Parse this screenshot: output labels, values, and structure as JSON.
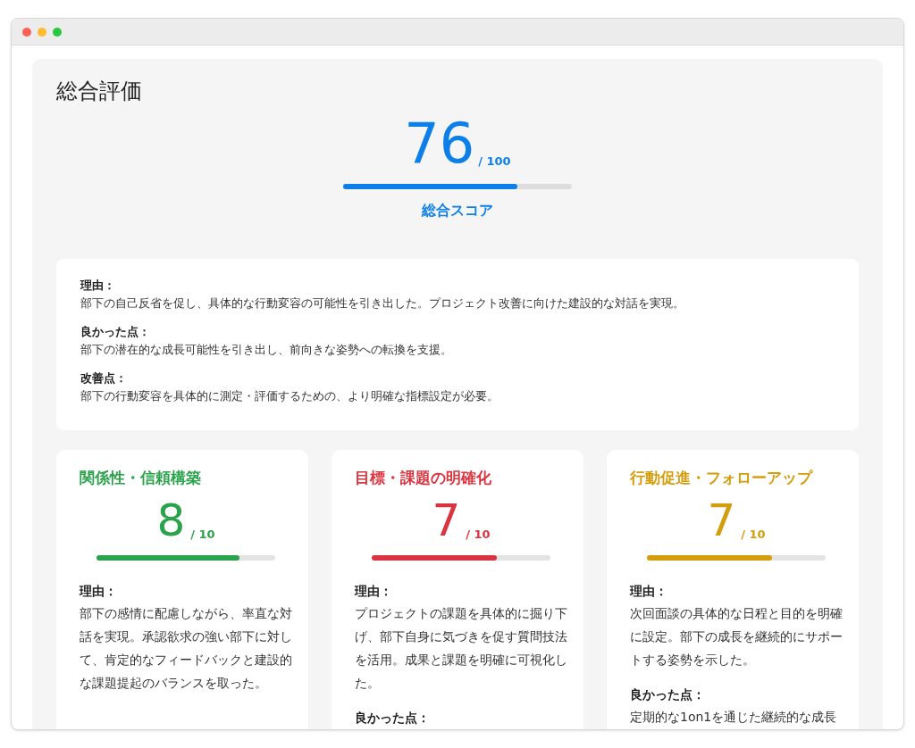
{
  "overall": {
    "title": "総合評価",
    "score": "76",
    "max": "/ 100",
    "level": 0.76,
    "label": "総合スコア"
  },
  "summary": [
    {
      "heading": "理由：",
      "text": "部下の自己反省を促し、具体的な行動変容の可能性を引き出した。プロジェクト改善に向けた建設的な対話を実現。"
    },
    {
      "heading": "良かった点：",
      "text": "部下の潜在的な成長可能性を引き出し、前向きな姿勢への転換を支援。"
    },
    {
      "heading": "改善点：",
      "text": "部下の行動変容を具体的に測定・評価するための、より明確な指標設定が必要。"
    }
  ],
  "categories": [
    {
      "title": "関係性・信頼構築",
      "color": "#2ba24c",
      "score": "8",
      "max": "/ 10",
      "level": 0.8,
      "sections": [
        {
          "heading": "理由：",
          "text": "部下の感情に配慮しながら、率直な対話を実現。承認欲求の強い部下に対して、肯定的なフィードバックと建設的な課題提起のバランスを取った。"
        }
      ]
    },
    {
      "title": "目標・課題の明確化",
      "color": "#d9343f",
      "score": "7",
      "max": "/ 10",
      "level": 0.7,
      "sections": [
        {
          "heading": "理由：",
          "text": "プロジェクトの課題を具体的に掘り下げ、部下自身に気づきを促す質問技法を活用。成果と課題を明確に可視化した。"
        },
        {
          "heading": "良かった点："
        }
      ]
    },
    {
      "title": "行動促進・フォローアップ",
      "color": "#d49d0c",
      "score": "7",
      "max": "/ 10",
      "level": 0.7,
      "sections": [
        {
          "heading": "理由：",
          "text": "次回面談の具体的な日程と目的を明確に設定。部下の成長を継続的にサポートする姿勢を示した。"
        },
        {
          "heading": "良かった点：",
          "text": "定期的な1on1を通じた継続的な成長"
        }
      ]
    }
  ]
}
